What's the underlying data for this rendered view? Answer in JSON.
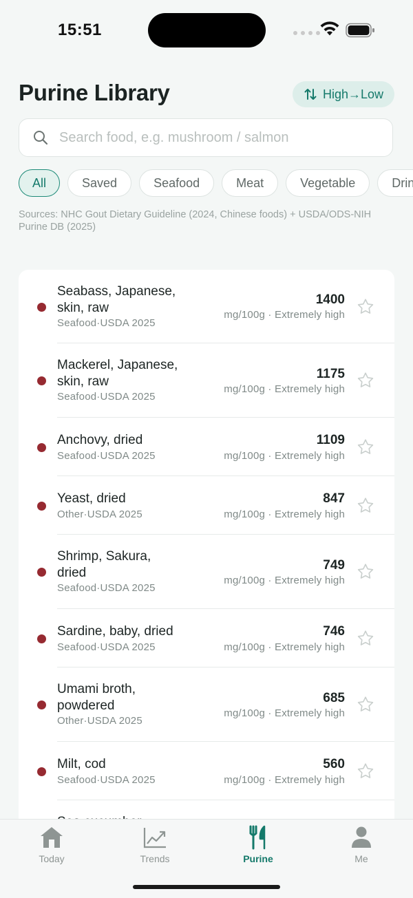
{
  "status_bar": {
    "time": "15:51"
  },
  "header": {
    "title": "Purine Library",
    "sort_label": "High→Low"
  },
  "search": {
    "placeholder": "Search food, e.g. mushroom / salmon",
    "value": ""
  },
  "filters": [
    "All",
    "Saved",
    "Seafood",
    "Meat",
    "Vegetable",
    "Drin"
  ],
  "active_filter": "All",
  "sources": "Sources: NHC Gout Dietary Guideline (2024, Chinese foods) + USDA/ODS-NIH Purine DB (2025)",
  "foods": [
    {
      "name": "Seabass, Japanese, skin, raw",
      "meta": "Seafood·USDA 2025",
      "value": "1400",
      "unit": "mg/100g · Extremely high"
    },
    {
      "name": "Mackerel, Japanese, skin, raw",
      "meta": "Seafood·USDA 2025",
      "value": "1175",
      "unit": "mg/100g · Extremely high"
    },
    {
      "name": "Anchovy, dried",
      "meta": "Seafood·USDA 2025",
      "value": "1109",
      "unit": "mg/100g · Extremely high"
    },
    {
      "name": "Yeast, dried",
      "meta": "Other·USDA 2025",
      "value": "847",
      "unit": "mg/100g · Extremely high"
    },
    {
      "name": "Shrimp, Sakura, dried",
      "meta": "Seafood·USDA 2025",
      "value": "749",
      "unit": "mg/100g · Extremely high"
    },
    {
      "name": "Sardine, baby, dried",
      "meta": "Seafood·USDA 2025",
      "value": "746",
      "unit": "mg/100g · Extremely high"
    },
    {
      "name": "Umami broth, powdered",
      "meta": "Other·USDA 2025",
      "value": "685",
      "unit": "mg/100g · Extremely high"
    },
    {
      "name": "Milt, cod",
      "meta": "Seafood·USDA 2025",
      "value": "560",
      "unit": "mg/100g · Extremely high"
    },
    {
      "name": "Sea cucumber",
      "meta": "",
      "value": "",
      "unit": ""
    }
  ],
  "tabs": [
    {
      "label": "Today",
      "icon": "home-icon"
    },
    {
      "label": "Trends",
      "icon": "chart-icon"
    },
    {
      "label": "Purine",
      "icon": "fork-knife-icon"
    },
    {
      "label": "Me",
      "icon": "person-icon"
    }
  ],
  "active_tab": "Purine",
  "colors": {
    "accent": "#14796a",
    "accent_bg": "#ddeeea",
    "level_extremely_high": "#962a31"
  }
}
